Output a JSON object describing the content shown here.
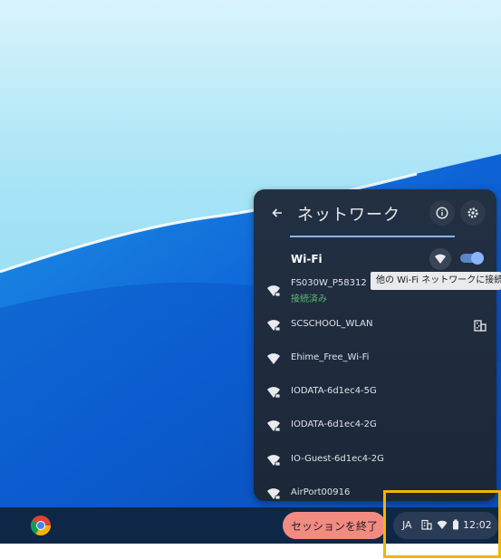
{
  "panel": {
    "title": "ネットワーク",
    "wifi_label": "Wi-Fi",
    "wifi_enabled": true,
    "networks": [
      {
        "name": "FS030W_P58312",
        "status": "接続済み",
        "icon": "wifi-lock-icon"
      },
      {
        "name": "SCSCHOOL_WLAN",
        "status": "",
        "icon": "wifi-lock-icon",
        "badge": "building-icon"
      },
      {
        "name": "Ehime_Free_Wi-Fi",
        "status": "",
        "icon": "wifi-icon"
      },
      {
        "name": "IODATA-6d1ec4-5G",
        "status": "",
        "icon": "wifi-lock-icon"
      },
      {
        "name": "IODATA-6d1ec4-2G",
        "status": "",
        "icon": "wifi-lock-icon"
      },
      {
        "name": "IO-Guest-6d1ec4-2G",
        "status": "",
        "icon": "wifi-lock-icon"
      },
      {
        "name": "AirPort00916",
        "status": "",
        "icon": "wifi-lock-icon"
      }
    ]
  },
  "tooltip": "他の Wi-Fi ネットワークに接続",
  "shelf": {
    "end_session": "セッションを終了",
    "ime": "JA",
    "clock": "12:02"
  },
  "colors": {
    "accent": "#8ab4f8",
    "connected": "#5bb974",
    "end_session_bg": "#f28b82",
    "highlight": "#f4b400"
  }
}
